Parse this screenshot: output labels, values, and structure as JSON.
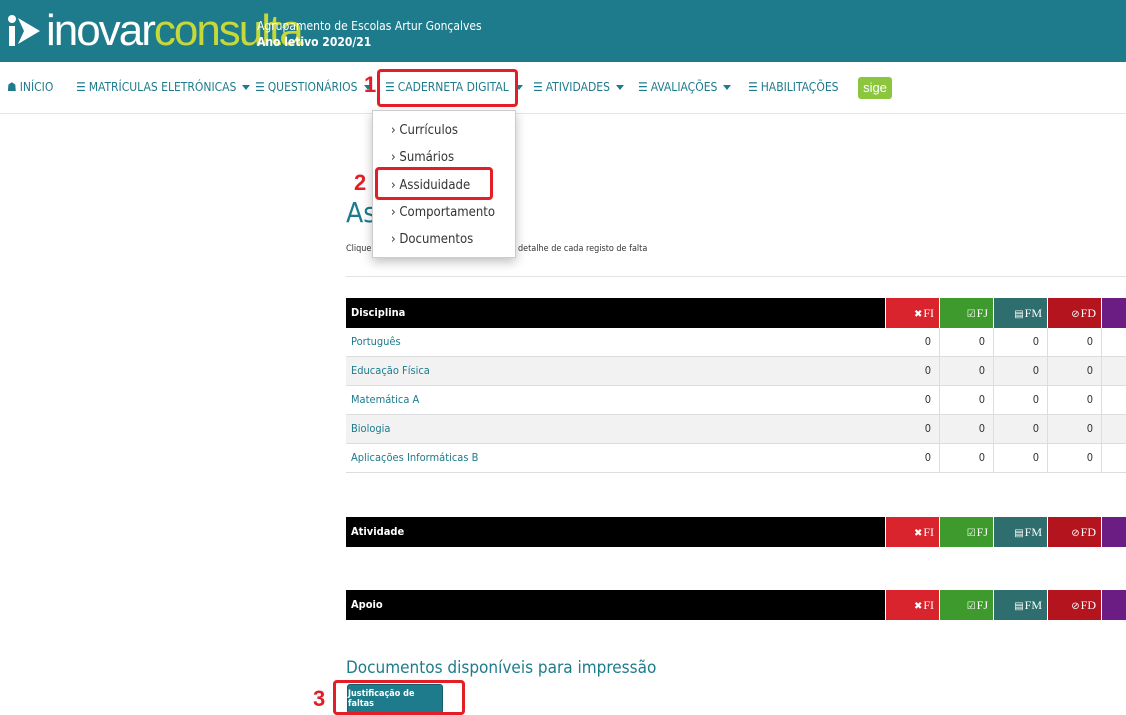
{
  "header": {
    "logo_text_1": "inovar",
    "logo_text_2": "consulta",
    "school": "Agrupamento de Escolas Artur Gonçalves",
    "year": "Ano letivo 2020/21",
    "colors": {
      "bar": "#1e7b8c",
      "accent": "#c6d83a"
    }
  },
  "nav": {
    "inicio": "INÍCIO",
    "matriculas": "MATRÍCULAS ELETRÓNICAS",
    "questionarios": "QUESTIONÁRIOS",
    "caderneta": "CADERNETA DIGITAL",
    "atividades": "ATIVIDADES",
    "avaliacoes": "AVALIAÇÕES",
    "habilitacoes": "HABILITAÇÕES",
    "sige": "sige"
  },
  "dropdown": {
    "items": [
      {
        "label": "› Currículos"
      },
      {
        "label": "› Sumários"
      },
      {
        "label": "› Assiduidade"
      },
      {
        "label": "› Comportamento"
      },
      {
        "label": "› Documentos"
      }
    ]
  },
  "page": {
    "title": "As",
    "instructions_head": "Clique",
    "instructions_tail": "detalhe de cada registo de falta"
  },
  "headers": {
    "fi": "FI",
    "fj": "FJ",
    "fm": "FM",
    "fd": "FD"
  },
  "disciplina": {
    "label": "Disciplina",
    "rows": [
      {
        "name": "Português",
        "fi": "0",
        "fj": "0",
        "fm": "0",
        "fd": "0"
      },
      {
        "name": "Educação Física",
        "fi": "0",
        "fj": "0",
        "fm": "0",
        "fd": "0"
      },
      {
        "name": "Matemática A",
        "fi": "0",
        "fj": "0",
        "fm": "0",
        "fd": "0"
      },
      {
        "name": "Biologia",
        "fi": "0",
        "fj": "0",
        "fm": "0",
        "fd": "0"
      },
      {
        "name": "Aplicações Informáticas B",
        "fi": "0",
        "fj": "0",
        "fm": "0",
        "fd": "0"
      }
    ]
  },
  "atividade": {
    "label": "Atividade"
  },
  "apoio": {
    "label": "Apoio"
  },
  "docs": {
    "title": "Documentos disponíveis para impressão",
    "button": "Justificação de faltas"
  },
  "annotations": {
    "n1": "1",
    "n2": "2",
    "n3": "3",
    "color": "#e41e26"
  }
}
